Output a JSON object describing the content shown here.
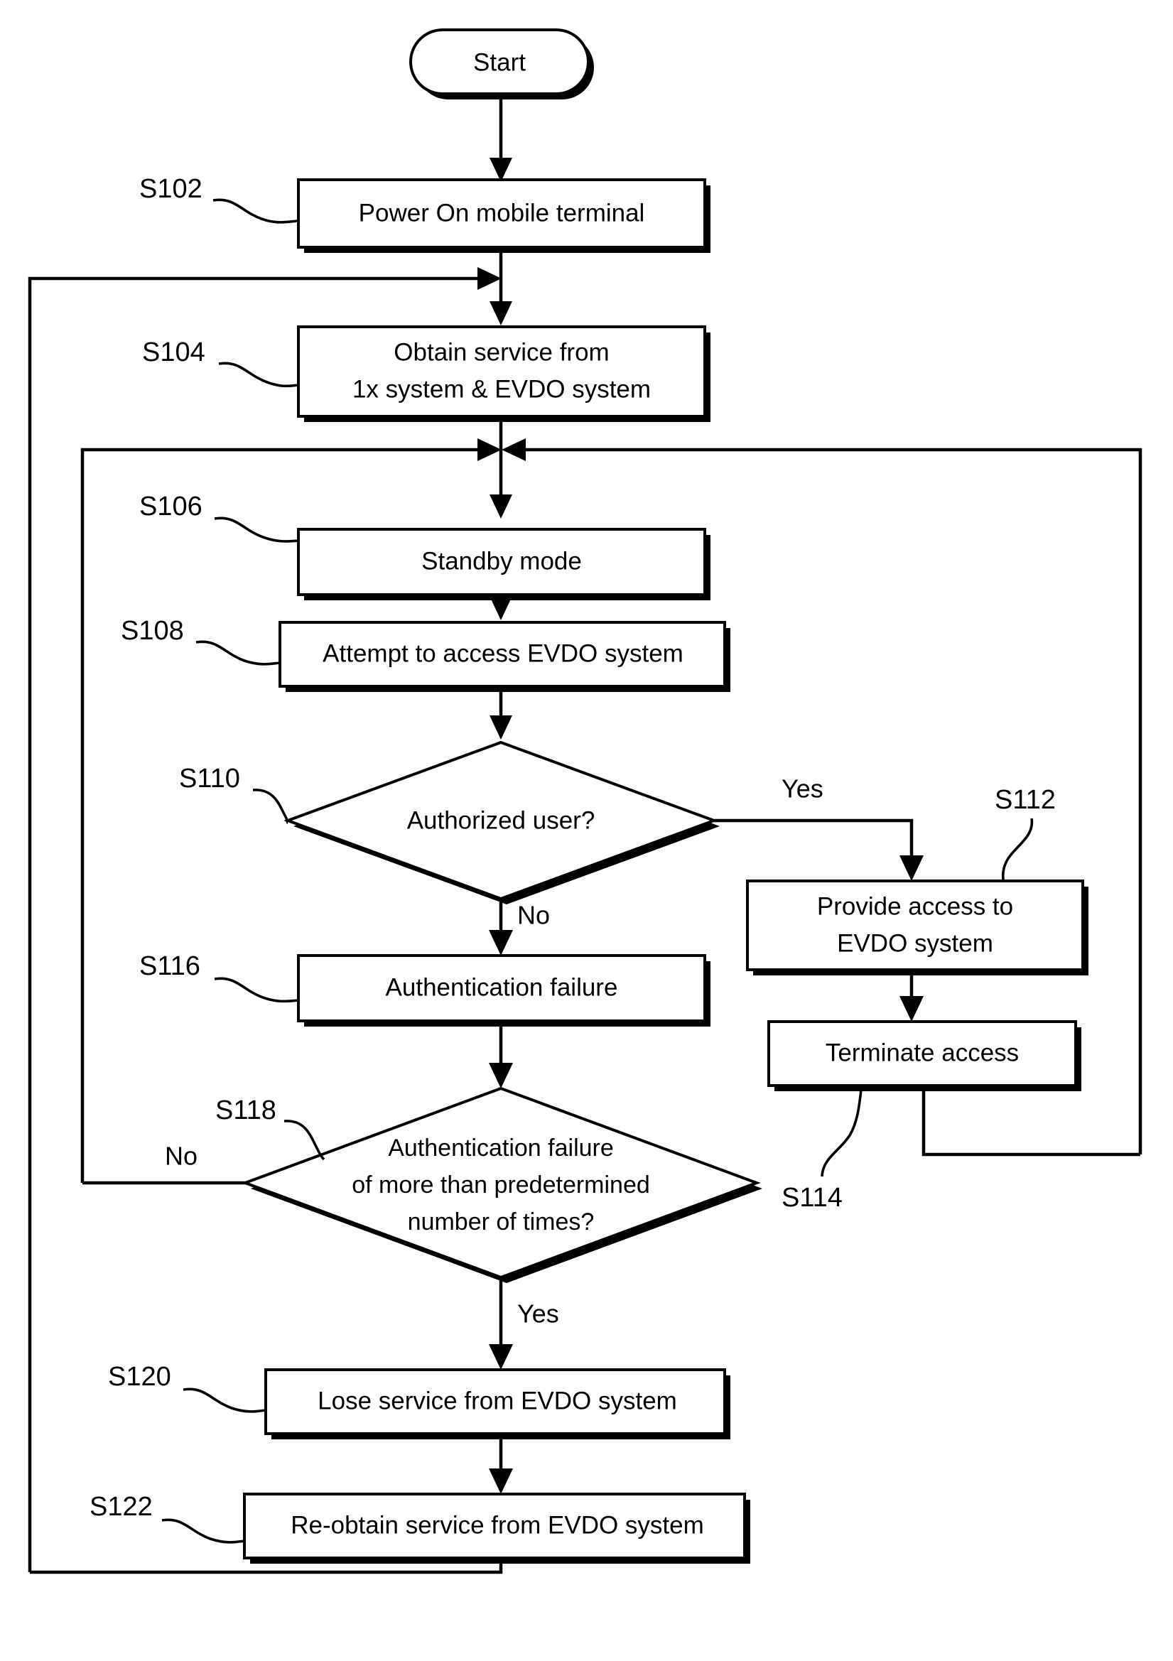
{
  "diagram": {
    "type": "flowchart",
    "title": "EVDO system access authentication flowchart",
    "orientation": "top-to-bottom",
    "nodes": [
      {
        "id": "start",
        "ref": "",
        "shape": "terminator",
        "lines": [
          "Start"
        ]
      },
      {
        "id": "s102",
        "ref": "S102",
        "shape": "process",
        "lines": [
          "Power On mobile terminal"
        ]
      },
      {
        "id": "s104",
        "ref": "S104",
        "shape": "process",
        "lines": [
          "Obtain service from",
          "1x system & EVDO system"
        ]
      },
      {
        "id": "s106",
        "ref": "S106",
        "shape": "process",
        "lines": [
          "Standby mode"
        ]
      },
      {
        "id": "s108",
        "ref": "S108",
        "shape": "process",
        "lines": [
          "Attempt to access EVDO system"
        ]
      },
      {
        "id": "s110",
        "ref": "S110",
        "shape": "decision",
        "lines": [
          "Authorized user?"
        ]
      },
      {
        "id": "s112",
        "ref": "S112",
        "shape": "process",
        "lines": [
          "Provide access to",
          "EVDO system"
        ]
      },
      {
        "id": "s114",
        "ref": "S114",
        "shape": "process",
        "lines": [
          "Terminate access"
        ]
      },
      {
        "id": "s116",
        "ref": "S116",
        "shape": "process",
        "lines": [
          "Authentication failure"
        ]
      },
      {
        "id": "s118",
        "ref": "S118",
        "shape": "decision",
        "lines": [
          "Authentication failure",
          "of more than predetermined",
          "number of times?"
        ]
      },
      {
        "id": "s120",
        "ref": "S120",
        "shape": "process",
        "lines": [
          "Lose service from EVDO system"
        ]
      },
      {
        "id": "s122",
        "ref": "S122",
        "shape": "process",
        "lines": [
          "Re-obtain service from EVDO system"
        ]
      }
    ],
    "edge_labels": {
      "s110_yes": "Yes",
      "s110_no": "No",
      "s118_no": "No",
      "s118_yes": "Yes"
    },
    "colors": {
      "stroke": "#000000",
      "fill": "#ffffff",
      "text": "#000000"
    }
  },
  "nodes": {
    "start": {
      "text": "Start"
    },
    "s102": {
      "ref": "S102",
      "l0": "Power On mobile terminal"
    },
    "s104": {
      "ref": "S104",
      "l0": "Obtain service from",
      "l1": "1x system & EVDO system"
    },
    "s106": {
      "ref": "S106",
      "l0": "Standby mode"
    },
    "s108": {
      "ref": "S108",
      "l0": "Attempt to access EVDO system"
    },
    "s110": {
      "ref": "S110",
      "l0": "Authorized user?"
    },
    "s112": {
      "ref": "S112",
      "l0": "Provide access to",
      "l1": "EVDO system"
    },
    "s114": {
      "ref": "S114",
      "l0": "Terminate access"
    },
    "s116": {
      "ref": "S116",
      "l0": "Authentication failure"
    },
    "s118": {
      "ref": "S118",
      "l0": "Authentication failure",
      "l1": "of more than predetermined",
      "l2": "number of times?"
    },
    "s120": {
      "ref": "S120",
      "l0": "Lose service from EVDO system"
    },
    "s122": {
      "ref": "S122",
      "l0": "Re-obtain service from EVDO system"
    }
  },
  "labels": {
    "yes_s110": "Yes",
    "no_s110": "No",
    "no_s118": "No",
    "yes_s118": "Yes"
  }
}
